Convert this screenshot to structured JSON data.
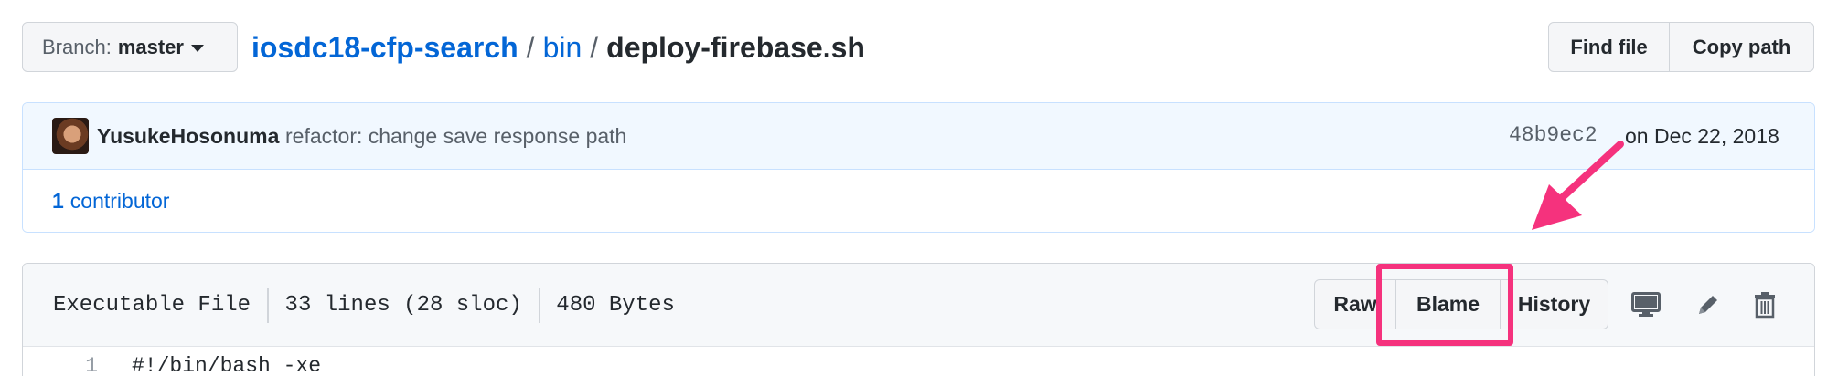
{
  "branch": {
    "prefix": "Branch:",
    "name": "master"
  },
  "breadcrumb": {
    "repo": "iosdc18-cfp-search",
    "sep1": "/",
    "dir": "bin",
    "sep2": "/",
    "file": "deploy-firebase.sh"
  },
  "file_nav": {
    "find_file": "Find file",
    "copy_path": "Copy path"
  },
  "commit": {
    "author": "YusukeHosonuma",
    "message": "refactor: change save response path",
    "sha": "48b9ec2",
    "date": "on Dec 22, 2018",
    "contributors_count": "1",
    "contributors_label": "contributor"
  },
  "file_info": {
    "type": "Executable File",
    "lines": "33 lines (28 sloc)",
    "size": "480 Bytes"
  },
  "actions": {
    "raw": "Raw",
    "blame": "Blame",
    "history": "History"
  },
  "icons": [
    "desktop-icon",
    "pencil-icon",
    "trash-icon"
  ],
  "code": [
    {
      "line": "1",
      "text": "#!/bin/bash -xe"
    }
  ],
  "colors": {
    "link": "#0366d6",
    "annotation": "#f5327d",
    "commit_bg": "#f1f8ff"
  }
}
